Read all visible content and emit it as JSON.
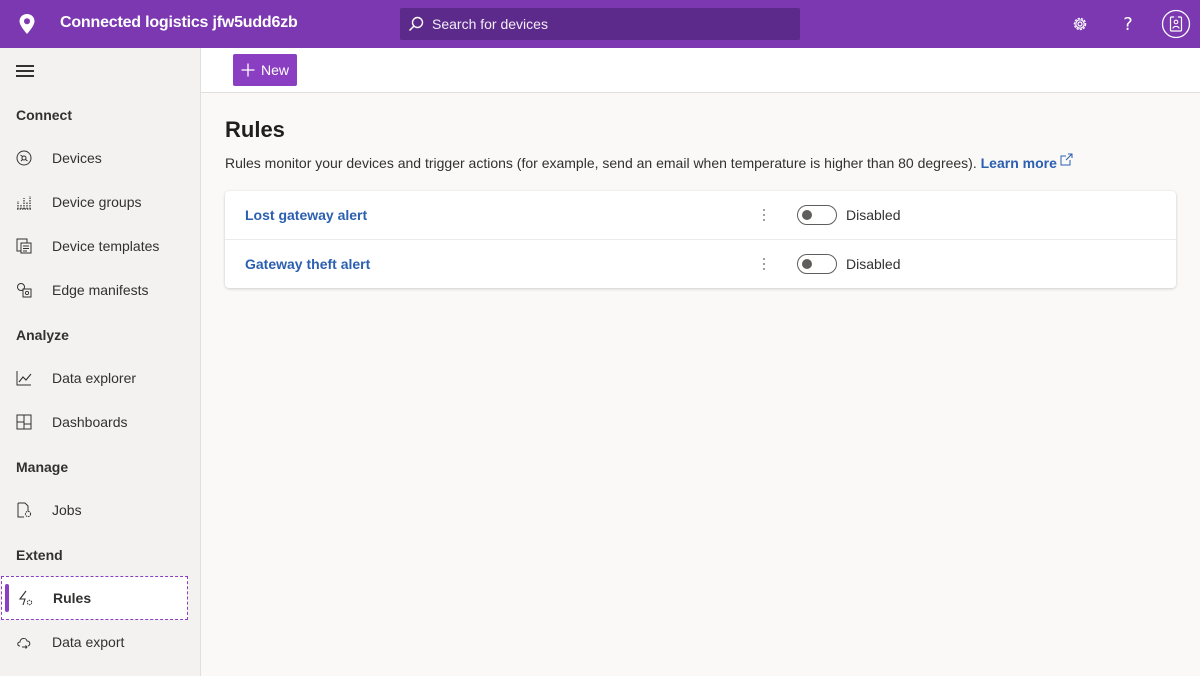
{
  "header": {
    "app_title": "Connected logistics jfw5udd6zb",
    "search_placeholder": "Search for devices",
    "settings_icon": "gear-icon",
    "help_icon": "question-icon",
    "help_glyph": "?",
    "avatar_icon": "user-badge-icon",
    "brand_color": "#7b38b0"
  },
  "sidebar": {
    "sections": {
      "connect": "Connect",
      "analyze": "Analyze",
      "manage": "Manage",
      "extend": "Extend"
    },
    "items": [
      {
        "label": "Devices",
        "icon": "devices-icon"
      },
      {
        "label": "Device groups",
        "icon": "device-groups-icon"
      },
      {
        "label": "Device templates",
        "icon": "device-templates-icon"
      },
      {
        "label": "Edge manifests",
        "icon": "edge-manifests-icon"
      },
      {
        "label": "Data explorer",
        "icon": "data-explorer-icon"
      },
      {
        "label": "Dashboards",
        "icon": "dashboards-icon"
      },
      {
        "label": "Jobs",
        "icon": "jobs-icon"
      },
      {
        "label": "Rules",
        "icon": "rules-icon",
        "active": true
      },
      {
        "label": "Data export",
        "icon": "data-export-icon"
      }
    ]
  },
  "toolbar": {
    "new_label": "New"
  },
  "main": {
    "title": "Rules",
    "description": "Rules monitor your devices and trigger actions (for example, send an email when temperature is higher than 80 degrees). ",
    "learn_more": "Learn more",
    "rules": [
      {
        "name": "Lost gateway alert",
        "status": "Disabled",
        "enabled": false
      },
      {
        "name": "Gateway theft alert",
        "status": "Disabled",
        "enabled": false
      }
    ]
  }
}
